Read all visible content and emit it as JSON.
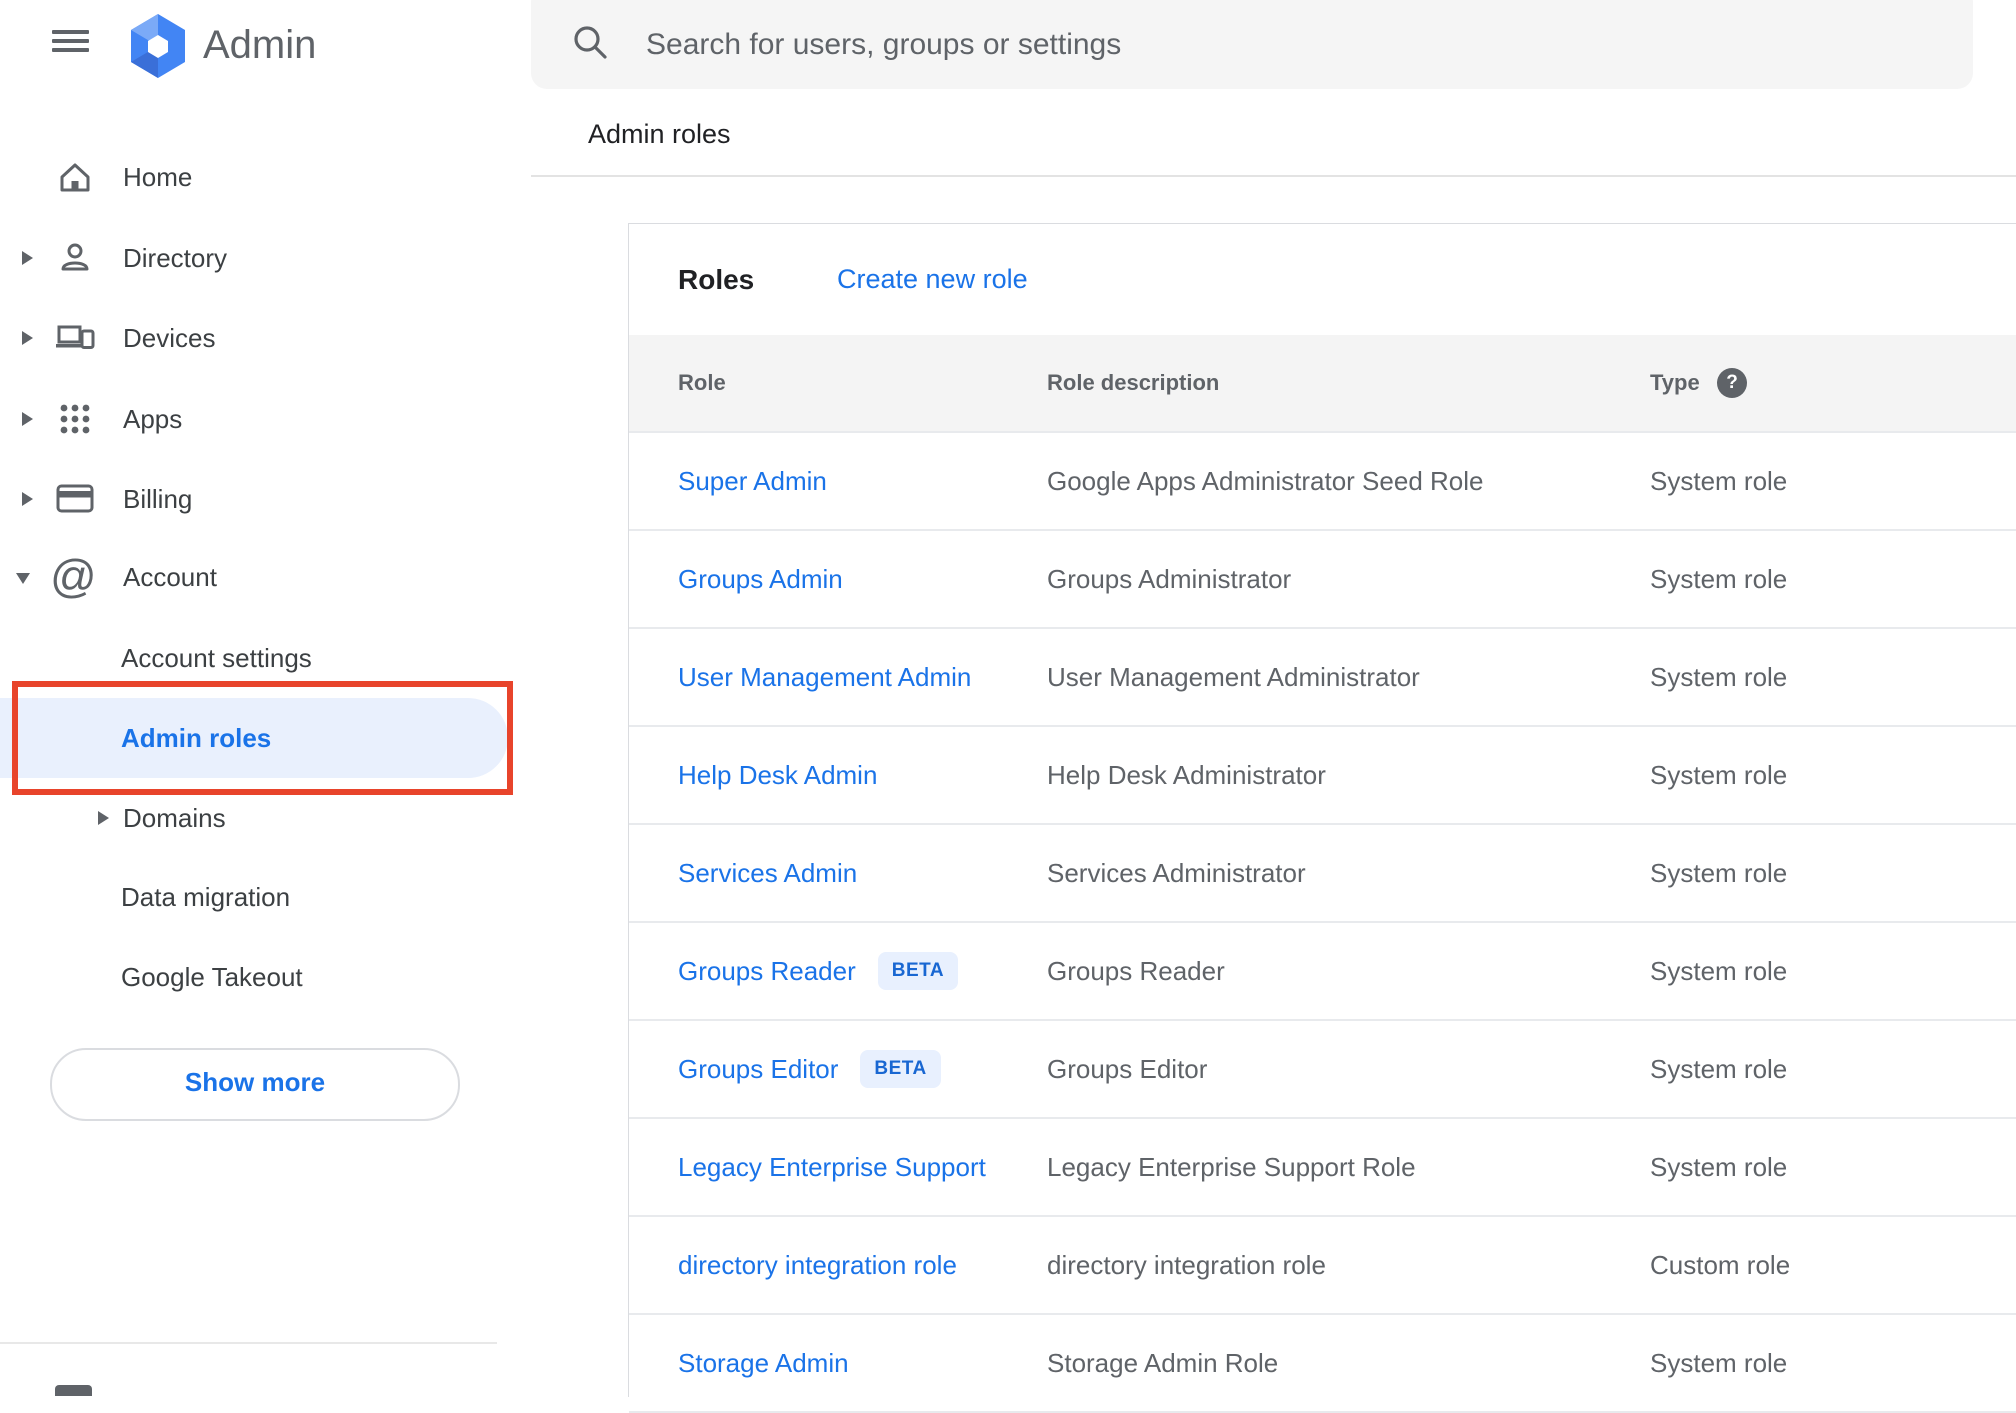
{
  "topbar": {
    "product_name": "Admin",
    "search_placeholder": "Search for users, groups or settings"
  },
  "breadcrumb": "Admin roles",
  "sidebar": {
    "items": [
      {
        "label": "Home"
      },
      {
        "label": "Directory",
        "expandable": true
      },
      {
        "label": "Devices",
        "expandable": true
      },
      {
        "label": "Apps",
        "expandable": true
      },
      {
        "label": "Billing",
        "expandable": true
      },
      {
        "label": "Account",
        "expanded": true
      },
      {
        "label": "Account settings",
        "indent": true
      },
      {
        "label": "Admin roles",
        "indent": true,
        "selected": true
      },
      {
        "label": "Domains",
        "indent": true,
        "expandable": true
      },
      {
        "label": "Data migration",
        "indent": true
      },
      {
        "label": "Google Takeout",
        "indent": true
      }
    ],
    "show_more_label": "Show more",
    "selected_text_color": "#1a73e8",
    "highlight_bg_color": "#e9f0fd",
    "annotation_box_color": "#e8442b"
  },
  "icons": {
    "menu": "hamburger-menu",
    "logo": "google-admin-hexagon",
    "search": "magnifier",
    "home": "house",
    "directory": "person",
    "devices": "laptop-and-phone",
    "apps": "dots-grid",
    "billing": "credit-card",
    "account": "at-sign",
    "help": "question-mark-circle"
  },
  "main": {
    "card_title": "Roles",
    "create_link_label": "Create new role",
    "table": {
      "columns": [
        "Role",
        "Role description",
        "Type"
      ],
      "beta_badge_label": "BETA",
      "link_color": "#1a73e8",
      "rows": [
        {
          "role": "Super Admin",
          "beta": false,
          "description": "Google Apps Administrator Seed Role",
          "type": "System role"
        },
        {
          "role": "Groups Admin",
          "beta": false,
          "description": "Groups Administrator",
          "type": "System role"
        },
        {
          "role": "User Management Admin",
          "beta": false,
          "description": "User Management Administrator",
          "type": "System role"
        },
        {
          "role": "Help Desk Admin",
          "beta": false,
          "description": "Help Desk Administrator",
          "type": "System role"
        },
        {
          "role": "Services Admin",
          "beta": false,
          "description": "Services Administrator",
          "type": "System role"
        },
        {
          "role": "Groups Reader",
          "beta": true,
          "description": "Groups Reader",
          "type": "System role"
        },
        {
          "role": "Groups Editor",
          "beta": true,
          "description": "Groups Editor",
          "type": "System role"
        },
        {
          "role": "Legacy Enterprise Support",
          "beta": false,
          "description": "Legacy Enterprise Support Role",
          "type": "System role"
        },
        {
          "role": "directory integration role",
          "beta": false,
          "description": "directory integration role",
          "type": "Custom role"
        },
        {
          "role": "Storage Admin",
          "beta": false,
          "description": "Storage Admin Role",
          "type": "System role"
        }
      ]
    }
  }
}
